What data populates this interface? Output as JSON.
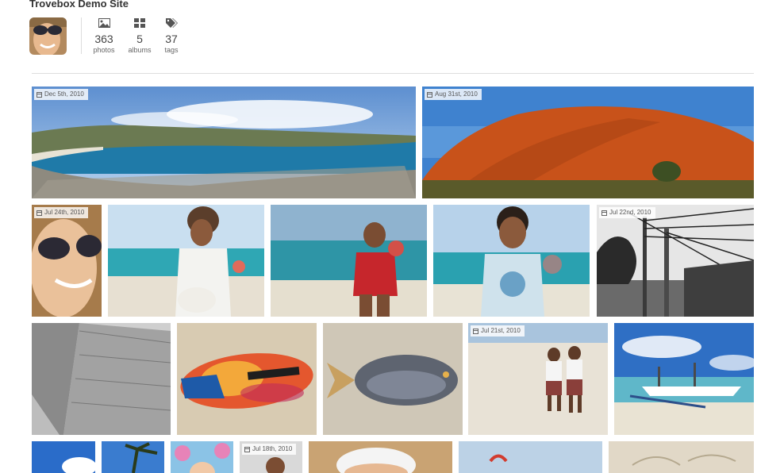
{
  "site": {
    "title": "Trovebox Demo Site"
  },
  "stats": [
    {
      "icon": "image-icon",
      "value": "363",
      "label": "photos"
    },
    {
      "icon": "albums-icon",
      "value": "5",
      "label": "albums"
    },
    {
      "icon": "tags-icon",
      "value": "37",
      "label": "tags"
    }
  ],
  "photos": {
    "p1_date": "Dec 5th, 2010",
    "p2_date": "Aug 31st, 2010",
    "p3_date": "Jul 24th, 2010",
    "p7_date": "Jul 22nd, 2010",
    "p11_date": "Jul 21st, 2010",
    "p16_date": "Jul 18th, 2010"
  }
}
